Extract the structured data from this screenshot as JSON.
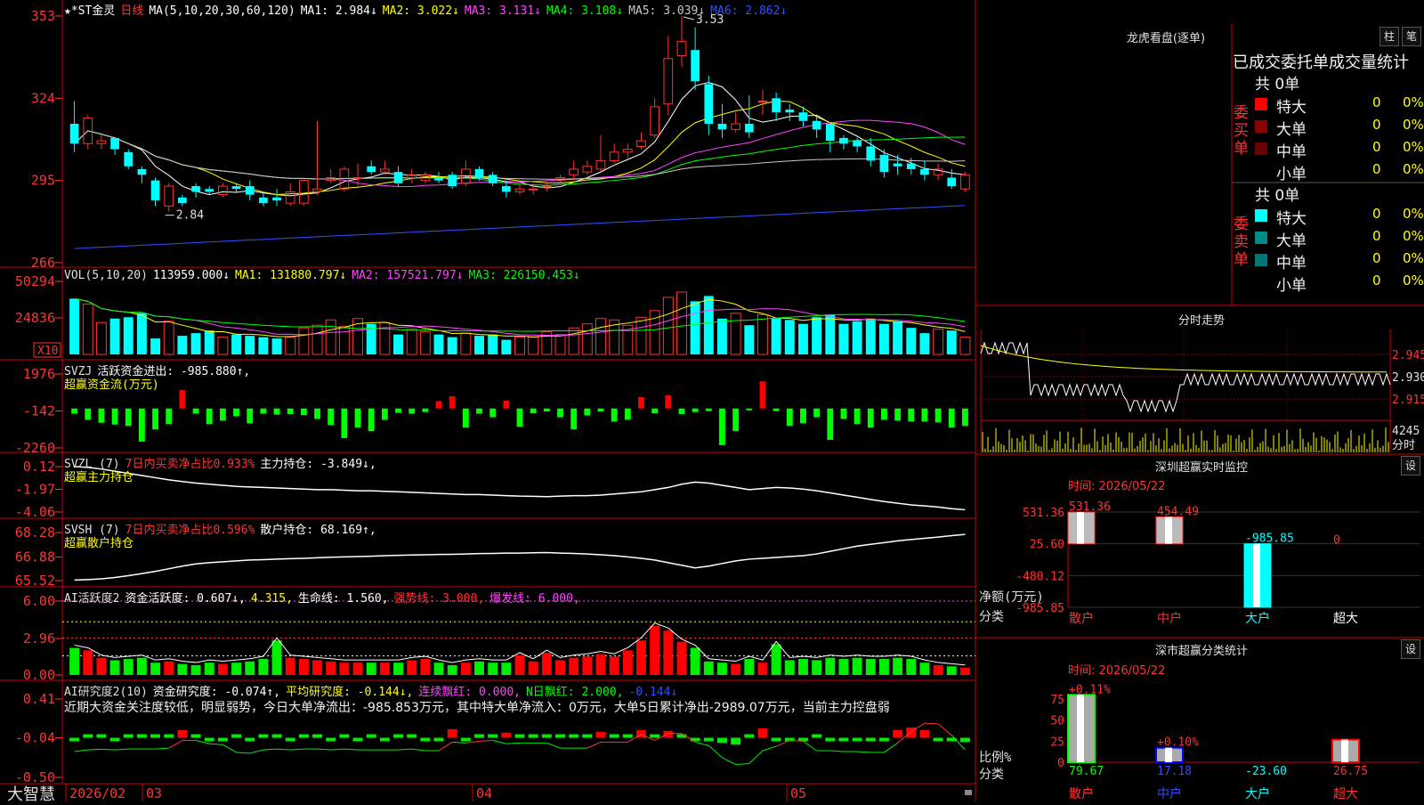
{
  "app_logo": "大智慧",
  "price_panel": {
    "stock_name": "★*ST金灵",
    "period": "日线",
    "indicator": "MA(5,10,20,30,60,120)",
    "ma_labels": [
      {
        "text": "MA1: 2.984↓",
        "color": "#ffffff"
      },
      {
        "text": "MA2: 3.022↓",
        "color": "#ffff00"
      },
      {
        "text": "MA3: 3.131↓",
        "color": "#ff44ff"
      },
      {
        "text": "MA4: 3.108↓",
        "color": "#00ff00"
      },
      {
        "text": "MA5: 3.039↓",
        "color": "#c8c8c8"
      },
      {
        "text": "MA6: 2.862↓",
        "color": "#3050ff"
      }
    ],
    "y_ticks": [
      "353",
      "324",
      "295",
      "266"
    ],
    "high_label": "3.53",
    "low_label": "2.84"
  },
  "vol_panel": {
    "title": "VOL(5,10,20)",
    "labels": [
      {
        "text": "113959.000↓",
        "color": "#ffffff"
      },
      {
        "text": "MA1: 131880.797↓",
        "color": "#ffff00"
      },
      {
        "text": "MA2: 157521.797↓",
        "color": "#ff44ff"
      },
      {
        "text": "MA3: 226150.453↓",
        "color": "#00ff00"
      }
    ],
    "y_ticks": [
      "50294",
      "24836"
    ],
    "unit": "X10"
  },
  "svzj_panel": {
    "title": "SVZJ",
    "label": "活跃资金进出: -985.880↑,",
    "subtitle": "超赢资金流(万元)",
    "y_ticks": [
      "1976",
      "-142",
      "-2260"
    ]
  },
  "svzl_panel": {
    "title": "SVZL (7)",
    "label_red": "7日内买卖净占比0.933%",
    "label_white": "主力持仓: -3.849↓,",
    "subtitle": "超赢主力持仓",
    "y_ticks": [
      "0.12",
      "-1.97",
      "-4.06"
    ]
  },
  "svsh_panel": {
    "title": "SVSH (7)",
    "label_red": "7日内买卖净占比0.596%",
    "label_white": "散户持仓: 68.169↑,",
    "subtitle": "超赢散户持仓",
    "y_ticks": [
      "68.28",
      "66.88",
      "65.52"
    ]
  },
  "ai_activity_panel": {
    "title": "AI活跃度2",
    "labels": [
      {
        "text": "资金活跃度: 0.607↓,",
        "color": "#ffffff"
      },
      {
        "text": "4.315,",
        "color": "#ffff00"
      },
      {
        "text": "生命线: 1.560,",
        "color": "#ffffff"
      },
      {
        "text": "强势线: 3.000,",
        "color": "#ff3333"
      },
      {
        "text": "爆发线: 6.000,",
        "color": "#ff44ff"
      }
    ],
    "y_ticks": [
      "6.00",
      "2.96",
      "0.00"
    ]
  },
  "ai_research_panel": {
    "title": "AI研究度2(10)",
    "labels": [
      {
        "text": "资金研究度: -0.074↑,",
        "color": "#ffffff"
      },
      {
        "text": "平均研究度: -0.144↓,",
        "color": "#ffff00"
      },
      {
        "text": "连续飘红: 0.000,",
        "color": "#ff44ff"
      },
      {
        "text": "N日飘红: 2.000,",
        "color": "#00ff00"
      },
      {
        "text": "-0.144↓",
        "color": "#3050ff"
      }
    ],
    "advice": "近期大资金关注度较低，明显弱势，今日大单净流出：-985.853万元，其中特大单净流入：0万元，大单5日累计净出-2989.07万元，当前主力控盘弱",
    "y_ticks": [
      "0.41",
      "-0.04",
      "-0.50"
    ]
  },
  "x_axis": {
    "labels": [
      "2026/02",
      "03",
      "04",
      "05"
    ]
  },
  "dragon_panel": {
    "title": "龙虎看盘(逐单)",
    "btn_col": "柱",
    "btn_pen": "笔",
    "header": "已成交委托单成交量统计",
    "buy": {
      "side_label": "委买单",
      "total": "共 0单",
      "rows": [
        {
          "name": "特大",
          "val": "0",
          "pct": "0%",
          "color": "#ff0000"
        },
        {
          "name": "大单",
          "val": "0",
          "pct": "0%",
          "color": "#8b0000"
        },
        {
          "name": "中单",
          "val": "0",
          "pct": "0%",
          "color": "#6b0000"
        },
        {
          "name": "小单",
          "val": "0",
          "pct": "0%",
          "color": ""
        }
      ]
    },
    "sell": {
      "side_label": "委卖单",
      "total": "共 0单",
      "rows": [
        {
          "name": "特大",
          "val": "0",
          "pct": "0%",
          "color": "#00ffff"
        },
        {
          "name": "大单",
          "val": "0",
          "pct": "0%",
          "color": "#008b8b"
        },
        {
          "name": "中单",
          "val": "0",
          "pct": "0%",
          "color": "#007777"
        },
        {
          "name": "小单",
          "val": "0",
          "pct": "0%",
          "color": ""
        }
      ]
    }
  },
  "intraday_panel": {
    "title": "分时走势",
    "price_ticks": [
      "2.945",
      "2.930",
      "2.915"
    ],
    "vol_tick": "4245",
    "vol_unit": "分时"
  },
  "sz_monitor_panel": {
    "title": "深圳超赢实时监控",
    "set_btn": "设",
    "time_label": "时间: 2026/05/22",
    "y_ticks": [
      "531.36",
      "25.60",
      "-480.12",
      "-985.85"
    ],
    "ylabel": "净额(万元)",
    "xlabel": "分类",
    "bars": [
      {
        "cat": "散户",
        "value": 531.36,
        "label": "531.36"
      },
      {
        "cat": "中户",
        "value": 454.49,
        "label": "454.49"
      },
      {
        "cat": "大户",
        "value": -985.85,
        "label": "-985.85"
      },
      {
        "cat": "超大",
        "value": 0,
        "label": "0"
      }
    ]
  },
  "sz_stats_panel": {
    "title": "深市超赢分类统计",
    "set_btn": "设",
    "time_label": "时间: 2026/05/22",
    "y_ticks": [
      "75",
      "50",
      "25",
      "0"
    ],
    "ylabel": "比例%",
    "xlabel": "分类",
    "bars": [
      {
        "cat": "散户",
        "pct_label": "+0.11%",
        "value_label": "79.67",
        "value": 79.67
      },
      {
        "cat": "中户",
        "pct_label": "+0.10%",
        "value_label": "17.18",
        "value": 17.18
      },
      {
        "cat": "大户",
        "pct_label": "",
        "value_label": "-23.60",
        "value": -23.6
      },
      {
        "cat": "超大",
        "pct_label": "",
        "value_label": "26.75",
        "value": 26.75
      }
    ]
  },
  "chart_data": [
    {
      "type": "candlestick",
      "title": "★*ST金灵 日线",
      "ylim": [
        2.66,
        3.53
      ],
      "open": [
        3.15,
        3.08,
        3.08,
        3.1,
        3.05,
        2.99,
        2.95,
        2.86,
        2.89,
        2.93,
        2.92,
        2.9,
        2.93,
        2.93,
        2.89,
        2.89,
        2.87,
        2.87,
        2.91,
        2.95,
        2.92,
        2.96,
        3.0,
        2.98,
        2.98,
        2.96,
        2.95,
        2.96,
        2.97,
        2.94,
        2.99,
        2.97,
        2.93,
        2.91,
        2.92,
        2.93,
        2.95,
        2.97,
        2.98,
        2.99,
        3.02,
        3.05,
        3.07,
        3.11,
        3.22,
        3.39,
        3.41,
        3.29,
        3.15,
        3.13,
        3.15,
        3.23,
        3.24,
        3.2,
        3.19,
        3.16,
        3.15,
        3.1,
        3.09,
        3.07,
        3.04,
        3.01,
        3.01,
        2.99,
        2.97,
        2.96,
        2.92
      ],
      "close": [
        3.08,
        3.17,
        3.09,
        3.06,
        3.0,
        2.97,
        2.88,
        2.93,
        2.87,
        2.91,
        2.91,
        2.93,
        2.92,
        2.9,
        2.87,
        2.88,
        2.91,
        2.95,
        2.92,
        2.96,
        2.99,
        2.96,
        2.98,
        2.99,
        2.94,
        2.97,
        2.97,
        2.95,
        2.93,
        2.99,
        2.96,
        2.94,
        2.91,
        2.92,
        2.92,
        2.93,
        2.96,
        2.99,
        3.0,
        3.02,
        3.05,
        3.06,
        3.09,
        3.21,
        3.38,
        3.44,
        3.3,
        3.15,
        3.13,
        3.15,
        3.12,
        3.23,
        3.19,
        3.19,
        3.16,
        3.13,
        3.09,
        3.08,
        3.07,
        3.02,
        2.98,
        3.0,
        2.99,
        2.97,
        2.99,
        2.93,
        2.97
      ],
      "high": [
        3.23,
        3.18,
        3.11,
        3.1,
        3.06,
        3.0,
        2.96,
        2.94,
        2.9,
        2.94,
        2.93,
        2.94,
        2.94,
        2.95,
        2.91,
        2.92,
        2.94,
        2.96,
        3.16,
        2.99,
        3.0,
        3.01,
        3.02,
        3.02,
        3.0,
        2.99,
        2.98,
        2.98,
        2.98,
        3.02,
        3.0,
        2.98,
        2.95,
        2.94,
        2.94,
        2.95,
        2.97,
        3.02,
        3.02,
        3.11,
        3.08,
        3.08,
        3.12,
        3.24,
        3.46,
        3.53,
        3.49,
        3.32,
        3.22,
        3.19,
        3.25,
        3.27,
        3.26,
        3.22,
        3.21,
        3.18,
        3.15,
        3.11,
        3.1,
        3.1,
        3.06,
        3.04,
        3.03,
        3.02,
        3.01,
        2.99,
        2.98
      ],
      "low": [
        3.05,
        3.06,
        3.06,
        3.04,
        2.99,
        2.94,
        2.86,
        2.84,
        2.86,
        2.89,
        2.9,
        2.89,
        2.91,
        2.88,
        2.86,
        2.86,
        2.86,
        2.86,
        2.9,
        2.94,
        2.91,
        2.93,
        2.97,
        2.97,
        2.93,
        2.94,
        2.94,
        2.94,
        2.92,
        2.93,
        2.95,
        2.93,
        2.89,
        2.9,
        2.9,
        2.91,
        2.94,
        2.95,
        2.97,
        2.98,
        3.01,
        3.03,
        3.06,
        3.1,
        3.18,
        3.35,
        3.27,
        3.11,
        3.1,
        3.12,
        3.1,
        3.18,
        3.16,
        3.16,
        3.14,
        3.1,
        3.05,
        3.06,
        3.05,
        3.0,
        2.96,
        2.97,
        2.97,
        2.95,
        2.95,
        2.92,
        2.91
      ]
    },
    {
      "type": "bar",
      "title": "VOL(5,10,20)",
      "values": [
        42000,
        38000,
        24000,
        27000,
        28000,
        31000,
        12000,
        25000,
        14000,
        16000,
        18000,
        13000,
        15000,
        14000,
        13000,
        12000,
        13000,
        20000,
        22000,
        26000,
        21000,
        27000,
        23000,
        24000,
        15000,
        19000,
        17000,
        15000,
        13000,
        16000,
        14000,
        15000,
        11000,
        13000,
        13000,
        17000,
        15000,
        20000,
        23000,
        27000,
        26000,
        22000,
        28000,
        33000,
        43000,
        47000,
        40000,
        44000,
        27000,
        31000,
        22000,
        30000,
        27000,
        26000,
        23000,
        28000,
        30000,
        23000,
        25000,
        27000,
        23000,
        25000,
        20000,
        16000,
        19000,
        18000,
        13000
      ],
      "ylim": [
        0,
        55000
      ]
    },
    {
      "type": "bar",
      "title": "超赢资金流(万元)",
      "values": [
        -300,
        -650,
        -820,
        -920,
        -1000,
        -1900,
        -1200,
        -900,
        1050,
        -300,
        -900,
        -700,
        -450,
        -850,
        -300,
        -350,
        -320,
        -380,
        -600,
        -950,
        -1700,
        -1100,
        -1300,
        -650,
        -250,
        -300,
        -200,
        420,
        700,
        -1100,
        -300,
        -500,
        450,
        -1050,
        -280,
        -170,
        -500,
        -1200,
        -400,
        -180,
        -750,
        -640,
        650,
        -280,
        750,
        -320,
        -200,
        -150,
        -2100,
        -1300,
        -100,
        1550,
        -150,
        -1000,
        -850,
        -500,
        -1800,
        -600,
        -900,
        -1100,
        -650,
        -700,
        -750,
        -750,
        -800,
        -1100,
        -1000
      ],
      "ylim": [
        -2260,
        1976
      ]
    },
    {
      "type": "line",
      "title": "超赢主力持仓",
      "values": [
        0.12,
        0.05,
        -0.1,
        -0.3,
        -0.5,
        -0.7,
        -0.9,
        -1.1,
        -1.25,
        -1.4,
        -1.5,
        -1.6,
        -1.7,
        -1.75,
        -1.8,
        -1.85,
        -1.9,
        -1.95,
        -2.0,
        -2.0,
        -2.05,
        -2.1,
        -2.1,
        -2.15,
        -2.2,
        -2.25,
        -2.3,
        -2.35,
        -2.4,
        -2.45,
        -2.45,
        -2.5,
        -2.55,
        -2.6,
        -2.62,
        -2.65,
        -2.6,
        -2.55,
        -2.55,
        -2.5,
        -2.4,
        -2.3,
        -2.2,
        -2.0,
        -1.8,
        -1.5,
        -1.3,
        -1.4,
        -1.6,
        -1.8,
        -2.0,
        -1.9,
        -1.8,
        -1.85,
        -1.95,
        -2.1,
        -2.3,
        -2.5,
        -2.7,
        -2.9,
        -3.1,
        -3.25,
        -3.4,
        -3.5,
        -3.6,
        -3.75,
        -3.85
      ],
      "ylim": [
        -4.06,
        0.12
      ]
    },
    {
      "type": "line",
      "title": "超赢散户持仓",
      "values": [
        65.55,
        65.58,
        65.62,
        65.7,
        65.8,
        65.92,
        66.05,
        66.2,
        66.35,
        66.48,
        66.55,
        66.6,
        66.65,
        66.7,
        66.72,
        66.75,
        66.78,
        66.8,
        66.83,
        66.86,
        66.88,
        66.9,
        66.92,
        66.95,
        66.97,
        66.99,
        67.0,
        67.02,
        67.03,
        67.05,
        67.07,
        67.08,
        67.1,
        67.1,
        67.12,
        67.13,
        67.1,
        67.08,
        67.05,
        67.0,
        66.95,
        66.88,
        66.8,
        66.7,
        66.55,
        66.4,
        66.25,
        66.35,
        66.5,
        66.65,
        66.75,
        66.8,
        66.85,
        66.9,
        66.95,
        67.05,
        67.2,
        67.35,
        67.5,
        67.6,
        67.7,
        67.8,
        67.88,
        67.95,
        68.02,
        68.1,
        68.17
      ],
      "ylim": [
        65.52,
        68.28
      ]
    },
    {
      "type": "bar",
      "title": "AI活跃度2",
      "values": [
        2.2,
        2.0,
        1.4,
        1.2,
        1.3,
        1.4,
        1.0,
        1.1,
        0.9,
        0.8,
        1.0,
        0.9,
        1.0,
        1.1,
        1.3,
        2.8,
        1.4,
        1.3,
        1.2,
        1.1,
        1.0,
        1.0,
        1.0,
        1.0,
        1.0,
        1.2,
        1.3,
        1.0,
        0.8,
        1.0,
        1.1,
        1.0,
        1.0,
        1.6,
        1.1,
        1.8,
        1.2,
        1.4,
        1.5,
        1.7,
        1.5,
        2.0,
        2.8,
        4.0,
        3.6,
        2.7,
        2.2,
        1.1,
        1.0,
        0.9,
        1.3,
        1.0,
        2.5,
        1.2,
        1.3,
        1.2,
        1.4,
        1.3,
        1.4,
        1.3,
        1.3,
        1.4,
        1.3,
        1.0,
        0.8,
        0.7,
        0.6
      ],
      "ylim": [
        0,
        6.0
      ]
    },
    {
      "type": "bar",
      "title": "AI研究度2(10)",
      "values": [
        -0.05,
        -0.04,
        -0.04,
        -0.05,
        -0.04,
        -0.04,
        -0.04,
        -0.04,
        0.05,
        -0.04,
        -0.08,
        -0.05,
        -0.04,
        -0.05,
        -0.04,
        -0.04,
        -0.05,
        -0.04,
        -0.04,
        -0.05,
        -0.04,
        -0.05,
        -0.04,
        -0.05,
        -0.04,
        -0.04,
        -0.06,
        -0.05,
        0.06,
        -0.05,
        -0.04,
        -0.04,
        0.02,
        -0.04,
        -0.04,
        -0.04,
        -0.04,
        -0.04,
        -0.04,
        0.03,
        -0.04,
        -0.04,
        0.05,
        -0.04,
        0.04,
        -0.04,
        -0.05,
        -0.08,
        -0.1,
        -0.12,
        -0.04,
        0.07,
        -0.05,
        -0.05,
        -0.05,
        -0.04,
        -0.05,
        -0.06,
        -0.05,
        -0.05,
        -0.05,
        0.05,
        0.08,
        0.05,
        -0.06,
        -0.08,
        -0.09
      ],
      "ylim": [
        -0.5,
        0.41
      ]
    },
    {
      "type": "bar",
      "title": "深圳超赢实时监控",
      "categories": [
        "散户",
        "中户",
        "大户",
        "超大"
      ],
      "values": [
        531.36,
        454.49,
        -985.85,
        0
      ],
      "ylabel": "净额(万元)",
      "xlabel": "分类",
      "ylim": [
        -985.85,
        531.36
      ]
    },
    {
      "type": "bar",
      "title": "深市超赢分类统计",
      "categories": [
        "散户",
        "中户",
        "大户",
        "超大"
      ],
      "values": [
        79.67,
        17.18,
        -23.6,
        26.75
      ],
      "ylabel": "比例%",
      "xlabel": "分类",
      "ylim": [
        0,
        80
      ]
    }
  ]
}
